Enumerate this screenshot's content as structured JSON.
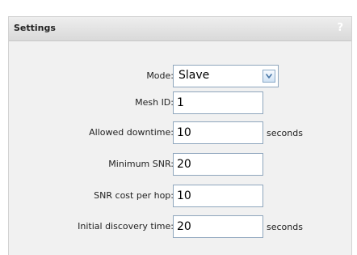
{
  "panel": {
    "title": "Settings",
    "help_icon_text": "?"
  },
  "fields": [
    {
      "label": "Mode:",
      "type": "select",
      "value": "Slave"
    },
    {
      "label": "Mesh ID:",
      "type": "text",
      "value": "1"
    },
    {
      "label": "Allowed downtime:",
      "type": "text",
      "value": "10",
      "unit": "seconds"
    },
    {
      "label": "Minimum SNR:",
      "type": "text",
      "value": "20"
    },
    {
      "label": "SNR cost per hop:",
      "type": "text",
      "value": "10"
    },
    {
      "label": "Initial discovery time:",
      "type": "text",
      "value": "20",
      "unit": "seconds"
    }
  ],
  "icons": {
    "help": "help-icon",
    "dropdown": "chevron-down-icon"
  },
  "colors": {
    "panel_background": "#f1f1f1",
    "field_border": "#8fa6bd",
    "dropdown_accent": "#4a77a8"
  }
}
